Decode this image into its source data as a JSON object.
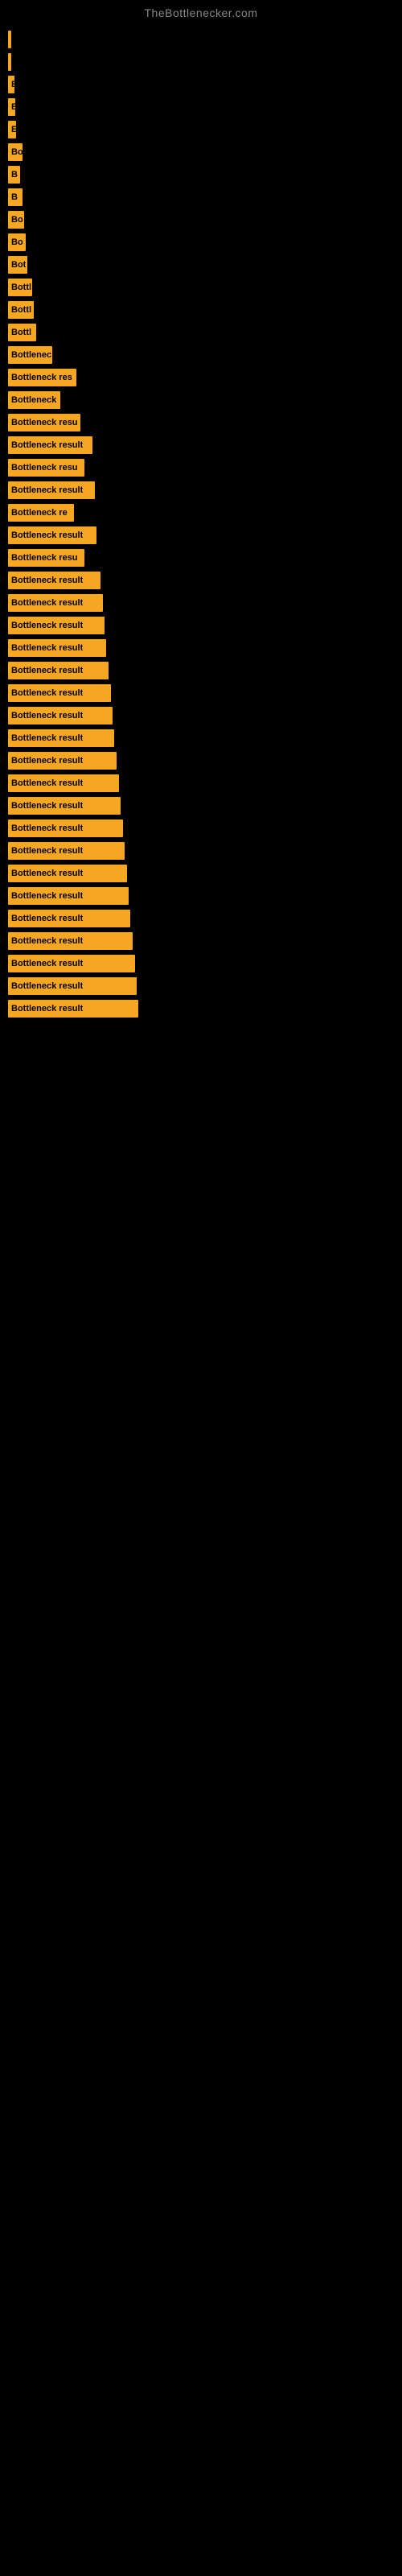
{
  "site": {
    "title": "TheBottlenecker.com"
  },
  "bars": [
    {
      "label": "|",
      "width": 4
    },
    {
      "label": "",
      "width": 4
    },
    {
      "label": "E",
      "width": 8
    },
    {
      "label": "B",
      "width": 9
    },
    {
      "label": "E",
      "width": 10
    },
    {
      "label": "Bo",
      "width": 18
    },
    {
      "label": "B",
      "width": 15
    },
    {
      "label": "B",
      "width": 18
    },
    {
      "label": "Bo",
      "width": 20
    },
    {
      "label": "Bo",
      "width": 22
    },
    {
      "label": "Bot",
      "width": 24
    },
    {
      "label": "Bottl",
      "width": 30
    },
    {
      "label": "Bottl",
      "width": 32
    },
    {
      "label": "Bottl",
      "width": 35
    },
    {
      "label": "Bottlenec",
      "width": 55
    },
    {
      "label": "Bottleneck res",
      "width": 85
    },
    {
      "label": "Bottleneck",
      "width": 65
    },
    {
      "label": "Bottleneck resu",
      "width": 90
    },
    {
      "label": "Bottleneck result",
      "width": 105
    },
    {
      "label": "Bottleneck resu",
      "width": 95
    },
    {
      "label": "Bottleneck result",
      "width": 108
    },
    {
      "label": "Bottleneck re",
      "width": 82
    },
    {
      "label": "Bottleneck result",
      "width": 110
    },
    {
      "label": "Bottleneck resu",
      "width": 95
    },
    {
      "label": "Bottleneck result",
      "width": 115
    },
    {
      "label": "Bottleneck result",
      "width": 118
    },
    {
      "label": "Bottleneck result",
      "width": 120
    },
    {
      "label": "Bottleneck result",
      "width": 122
    },
    {
      "label": "Bottleneck result",
      "width": 125
    },
    {
      "label": "Bottleneck result",
      "width": 128
    },
    {
      "label": "Bottleneck result",
      "width": 130
    },
    {
      "label": "Bottleneck result",
      "width": 132
    },
    {
      "label": "Bottleneck result",
      "width": 135
    },
    {
      "label": "Bottleneck result",
      "width": 138
    },
    {
      "label": "Bottleneck result",
      "width": 140
    },
    {
      "label": "Bottleneck result",
      "width": 143
    },
    {
      "label": "Bottleneck result",
      "width": 145
    },
    {
      "label": "Bottleneck result",
      "width": 148
    },
    {
      "label": "Bottleneck result",
      "width": 150
    },
    {
      "label": "Bottleneck result",
      "width": 152
    },
    {
      "label": "Bottleneck result",
      "width": 155
    },
    {
      "label": "Bottleneck result",
      "width": 158
    },
    {
      "label": "Bottleneck result",
      "width": 160
    },
    {
      "label": "Bottleneck result",
      "width": 162
    }
  ]
}
